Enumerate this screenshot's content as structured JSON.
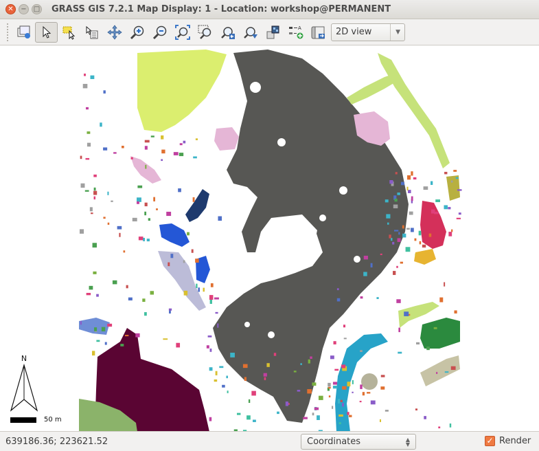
{
  "window": {
    "title": "GRASS GIS 7.2.1 Map Display: 1 - Location: workshop@PERMANENT",
    "close_glyph": "✕",
    "minimize_glyph": "−",
    "maximize_glyph": "□"
  },
  "toolbar": {
    "tools": [
      {
        "name": "add-map-layer-icon"
      },
      {
        "name": "pointer-icon",
        "active": true
      },
      {
        "name": "select-vector-icon"
      },
      {
        "name": "query-icon"
      },
      {
        "name": "pan-icon"
      },
      {
        "name": "zoom-in-icon"
      },
      {
        "name": "zoom-out-icon"
      },
      {
        "name": "zoom-extent-icon"
      },
      {
        "name": "zoom-region-icon"
      },
      {
        "name": "zoom-back-icon"
      },
      {
        "name": "zoom-menu-icon"
      },
      {
        "name": "analyze-icon"
      },
      {
        "name": "legend-icon"
      },
      {
        "name": "save-image-icon"
      }
    ],
    "view_mode": "2D view"
  },
  "map": {
    "north_label": "N",
    "scale_label": "50 m",
    "colors": {
      "gray_segment": "#575754",
      "maroon_segment": "#5a0533",
      "lime_segment": "#dbee6f",
      "pink_segment": "#e5b6d6",
      "navy_segment": "#1e3a6e",
      "blue_segment": "#2457d6",
      "crimson_segment": "#d4305a",
      "green_segment": "#2b8a3e",
      "teal_segment": "#27a3c8",
      "khaki_segment": "#c7c3a5",
      "lightgreen_segment": "#c6e27a",
      "sage_segment": "#8bb36a"
    }
  },
  "status": {
    "coordinates": "639186.36; 223621.52",
    "display_mode": "Coordinates",
    "render_label": "Render",
    "render_checked": true
  }
}
